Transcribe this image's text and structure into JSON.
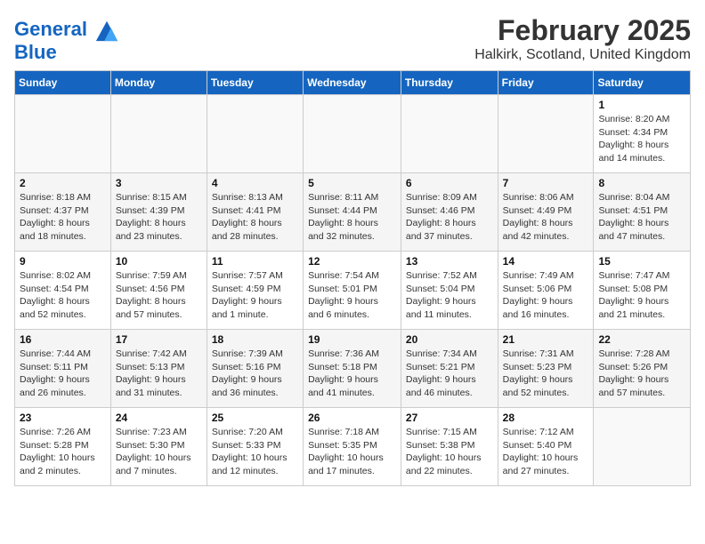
{
  "header": {
    "logo_line1": "General",
    "logo_line2": "Blue",
    "month": "February 2025",
    "location": "Halkirk, Scotland, United Kingdom"
  },
  "weekdays": [
    "Sunday",
    "Monday",
    "Tuesday",
    "Wednesday",
    "Thursday",
    "Friday",
    "Saturday"
  ],
  "weeks": [
    [
      {
        "day": "",
        "info": ""
      },
      {
        "day": "",
        "info": ""
      },
      {
        "day": "",
        "info": ""
      },
      {
        "day": "",
        "info": ""
      },
      {
        "day": "",
        "info": ""
      },
      {
        "day": "",
        "info": ""
      },
      {
        "day": "1",
        "info": "Sunrise: 8:20 AM\nSunset: 4:34 PM\nDaylight: 8 hours and 14 minutes."
      }
    ],
    [
      {
        "day": "2",
        "info": "Sunrise: 8:18 AM\nSunset: 4:37 PM\nDaylight: 8 hours and 18 minutes."
      },
      {
        "day": "3",
        "info": "Sunrise: 8:15 AM\nSunset: 4:39 PM\nDaylight: 8 hours and 23 minutes."
      },
      {
        "day": "4",
        "info": "Sunrise: 8:13 AM\nSunset: 4:41 PM\nDaylight: 8 hours and 28 minutes."
      },
      {
        "day": "5",
        "info": "Sunrise: 8:11 AM\nSunset: 4:44 PM\nDaylight: 8 hours and 32 minutes."
      },
      {
        "day": "6",
        "info": "Sunrise: 8:09 AM\nSunset: 4:46 PM\nDaylight: 8 hours and 37 minutes."
      },
      {
        "day": "7",
        "info": "Sunrise: 8:06 AM\nSunset: 4:49 PM\nDaylight: 8 hours and 42 minutes."
      },
      {
        "day": "8",
        "info": "Sunrise: 8:04 AM\nSunset: 4:51 PM\nDaylight: 8 hours and 47 minutes."
      }
    ],
    [
      {
        "day": "9",
        "info": "Sunrise: 8:02 AM\nSunset: 4:54 PM\nDaylight: 8 hours and 52 minutes."
      },
      {
        "day": "10",
        "info": "Sunrise: 7:59 AM\nSunset: 4:56 PM\nDaylight: 8 hours and 57 minutes."
      },
      {
        "day": "11",
        "info": "Sunrise: 7:57 AM\nSunset: 4:59 PM\nDaylight: 9 hours and 1 minute."
      },
      {
        "day": "12",
        "info": "Sunrise: 7:54 AM\nSunset: 5:01 PM\nDaylight: 9 hours and 6 minutes."
      },
      {
        "day": "13",
        "info": "Sunrise: 7:52 AM\nSunset: 5:04 PM\nDaylight: 9 hours and 11 minutes."
      },
      {
        "day": "14",
        "info": "Sunrise: 7:49 AM\nSunset: 5:06 PM\nDaylight: 9 hours and 16 minutes."
      },
      {
        "day": "15",
        "info": "Sunrise: 7:47 AM\nSunset: 5:08 PM\nDaylight: 9 hours and 21 minutes."
      }
    ],
    [
      {
        "day": "16",
        "info": "Sunrise: 7:44 AM\nSunset: 5:11 PM\nDaylight: 9 hours and 26 minutes."
      },
      {
        "day": "17",
        "info": "Sunrise: 7:42 AM\nSunset: 5:13 PM\nDaylight: 9 hours and 31 minutes."
      },
      {
        "day": "18",
        "info": "Sunrise: 7:39 AM\nSunset: 5:16 PM\nDaylight: 9 hours and 36 minutes."
      },
      {
        "day": "19",
        "info": "Sunrise: 7:36 AM\nSunset: 5:18 PM\nDaylight: 9 hours and 41 minutes."
      },
      {
        "day": "20",
        "info": "Sunrise: 7:34 AM\nSunset: 5:21 PM\nDaylight: 9 hours and 46 minutes."
      },
      {
        "day": "21",
        "info": "Sunrise: 7:31 AM\nSunset: 5:23 PM\nDaylight: 9 hours and 52 minutes."
      },
      {
        "day": "22",
        "info": "Sunrise: 7:28 AM\nSunset: 5:26 PM\nDaylight: 9 hours and 57 minutes."
      }
    ],
    [
      {
        "day": "23",
        "info": "Sunrise: 7:26 AM\nSunset: 5:28 PM\nDaylight: 10 hours and 2 minutes."
      },
      {
        "day": "24",
        "info": "Sunrise: 7:23 AM\nSunset: 5:30 PM\nDaylight: 10 hours and 7 minutes."
      },
      {
        "day": "25",
        "info": "Sunrise: 7:20 AM\nSunset: 5:33 PM\nDaylight: 10 hours and 12 minutes."
      },
      {
        "day": "26",
        "info": "Sunrise: 7:18 AM\nSunset: 5:35 PM\nDaylight: 10 hours and 17 minutes."
      },
      {
        "day": "27",
        "info": "Sunrise: 7:15 AM\nSunset: 5:38 PM\nDaylight: 10 hours and 22 minutes."
      },
      {
        "day": "28",
        "info": "Sunrise: 7:12 AM\nSunset: 5:40 PM\nDaylight: 10 hours and 27 minutes."
      },
      {
        "day": "",
        "info": ""
      }
    ]
  ]
}
